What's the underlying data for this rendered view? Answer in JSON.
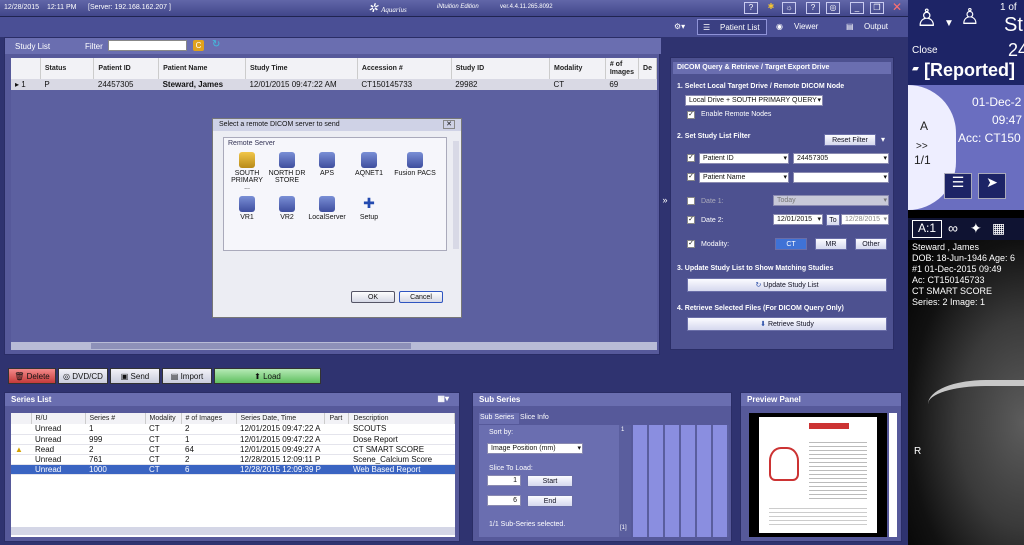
{
  "titlebar": {
    "date": "12/28/2015",
    "time": "12:11 PM",
    "server": "[Server: 192.168.162.207 ]",
    "app_name": "Aquarius",
    "edition": "iNtuition Edition",
    "version": "ver.4.4.11.265.8092"
  },
  "toolbar": {
    "tabs": [
      "Patient List",
      "Viewer",
      "Output"
    ]
  },
  "study_list": {
    "title": "Study List",
    "filter_label": "Filter",
    "columns": [
      "Status",
      "Patient ID",
      "Patient Name",
      "Study Time",
      "Accession #",
      "Study ID",
      "Modality",
      "# of Images",
      "De"
    ],
    "rows": [
      {
        "index": "1",
        "status": "P",
        "patient_id": "24457305",
        "patient_name": "Steward, James",
        "study_time": "12/01/2015  09:47:22 AM",
        "accession": "CT150145733",
        "study_id": "29982",
        "modality": "CT",
        "images": "69"
      }
    ]
  },
  "dialog": {
    "title": "Select a remote DICOM server to send",
    "group": "Remote Server",
    "servers": [
      "SOUTH PRIMARY ...",
      "NORTH DR STORE",
      "APS",
      "AQNET1",
      "Fusion PACS",
      "VR1",
      "VR2",
      "LocalServer",
      "Setup"
    ],
    "ok": "OK",
    "cancel": "Cancel"
  },
  "query": {
    "header": "DICOM Query & Retrieve / Target Export Drive",
    "step1": "1. Select Local Target Drive / Remote DICOM Node",
    "drive": "Local Drive + SOUTH PRIMARY QUERY",
    "enable_remote": "Enable Remote Nodes",
    "step2": "2. Set Study List Filter",
    "reset": "Reset Filter",
    "f1_field": "Patient ID",
    "f1_value": "24457305",
    "f2_field": "Patient Name",
    "f2_value": "",
    "date1_label": "Date 1:",
    "date1_value": "Today",
    "date2_label": "Date 2:",
    "date2_from": "12/01/2015",
    "to": "To",
    "date2_to": "12/28/2015",
    "modality_label": "Modality:",
    "modalities": [
      "CT",
      "MR",
      "Other"
    ],
    "step3": "3. Update Study List to Show Matching Studies",
    "update": "Update Study List",
    "step4": "4. Retrieve Selected Files (For DICOM Query Only)",
    "retrieve": "Retrieve Study"
  },
  "actions": [
    "Delete",
    "DVD/CD",
    "Send",
    "Import",
    "Load"
  ],
  "series": {
    "title": "Series List",
    "columns": [
      "R/U",
      "Series #",
      "Modality",
      "# of Images",
      "Series Date, Time",
      "Part",
      "Description"
    ],
    "rows": [
      {
        "ru": "Unread",
        "num": "1",
        "mod": "CT",
        "imgs": "2",
        "dt": "12/01/2015  09:47:22 A",
        "desc": "SCOUTS"
      },
      {
        "ru": "Unread",
        "num": "999",
        "mod": "CT",
        "imgs": "1",
        "dt": "12/01/2015  09:47:22 A",
        "desc": "Dose Report"
      },
      {
        "ru": "Read",
        "num": "2",
        "mod": "CT",
        "imgs": "64",
        "dt": "12/01/2015  09:49:27 A",
        "desc": "CT SMART SCORE"
      },
      {
        "ru": "Unread",
        "num": "761",
        "mod": "CT",
        "imgs": "2",
        "dt": "12/28/2015  12:09:11 P",
        "desc": "Scene_Calcium Score"
      },
      {
        "ru": "Unread",
        "num": "1000",
        "mod": "CT",
        "imgs": "6",
        "dt": "12/28/2015  12:09:39 P",
        "desc": "Web Based Report"
      }
    ]
  },
  "subseries": {
    "title": "Sub Series",
    "tabs": [
      "Sub Series",
      "Slice Info"
    ],
    "sort_by": "Sort by:",
    "sort_value": "Image Position (mm)",
    "slice_to_load": "Slice To Load:",
    "start_val": "1",
    "start": "Start",
    "end_val": "6",
    "end": "End",
    "status": "1/1 Sub-Series selected.",
    "marker1": "1",
    "marker2": "[1]"
  },
  "preview": {
    "title": "Preview Panel"
  },
  "viewer": {
    "close": "Close",
    "page": "1 of",
    "big": "St",
    "num": "24",
    "status": "[Reported]",
    "date": "01-Dec-2",
    "time": "09:47",
    "acc": "Acc: CT150",
    "side": "A",
    "nav": ">>",
    "frac": "1/1",
    "zoom": "A:1",
    "ov1": "Steward ,  James",
    "ov2": "DOB: 18-Jun-1946 Age: 6",
    "ov3": "#1   01-Dec-2015  09:49",
    "ov4": "Ac: CT150145733",
    "ov5": "CT SMART SCORE",
    "ov6": "Series: 2   Image: 1",
    "ov_r": "R"
  }
}
